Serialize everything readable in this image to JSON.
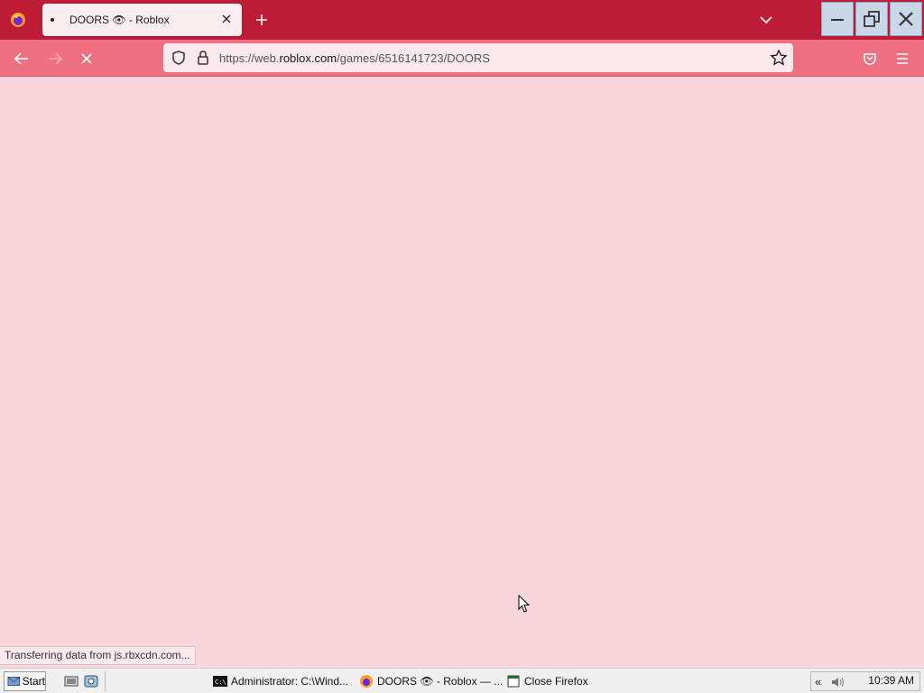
{
  "tab": {
    "title": "DOORS 👁 - Roblox"
  },
  "navbar": {
    "url_prefix": "https://web.",
    "url_domain": "roblox.com",
    "url_path": "/games/6516141723/DOORS"
  },
  "status": {
    "text": "Transferring data from js.rbxcdn.com..."
  },
  "taskbar": {
    "start_label": "Start",
    "items": [
      {
        "label": "Administrator: C:\\Wind..."
      },
      {
        "label": "DOORS 👁 - Roblox — ..."
      },
      {
        "label": "Close Firefox"
      }
    ],
    "clock": "10:39 AM"
  },
  "colors": {
    "tabstrip": "#bf1d37",
    "navbar": "#f07083",
    "content": "#f8d6dc"
  },
  "icons": [
    "firefox-icon",
    "close-icon",
    "plus-icon",
    "chevron-down-icon",
    "minimize-icon",
    "restore-icon",
    "back-icon",
    "forward-icon",
    "stop-icon",
    "shield-icon",
    "lock-icon",
    "star-icon",
    "pocket-icon",
    "menu-icon"
  ]
}
